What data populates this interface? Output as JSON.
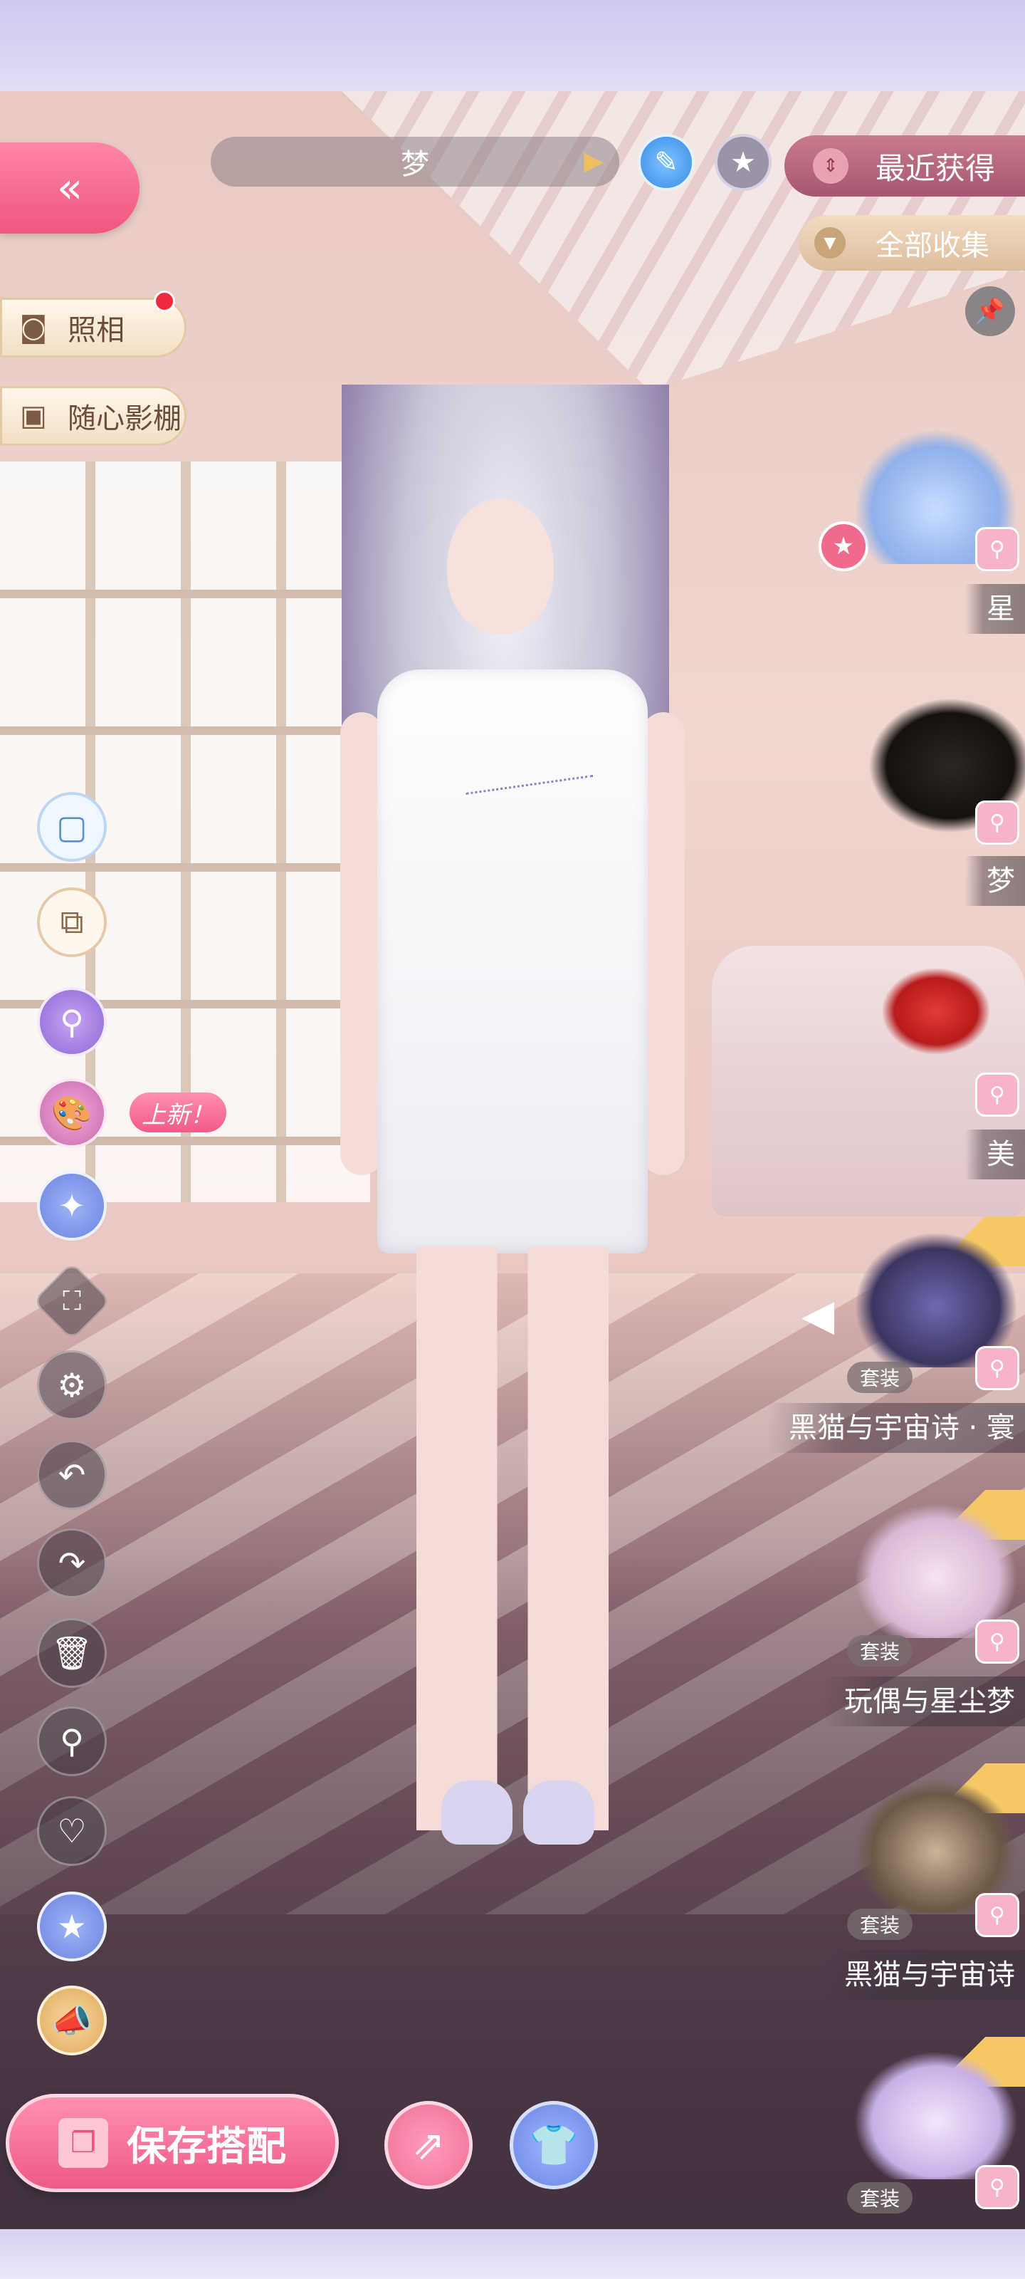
{
  "header": {
    "title": "梦",
    "recent_label": "最近获得",
    "all_label": "全部收集"
  },
  "left_menu": {
    "photo_label": "照相",
    "studio_label": "随心影棚",
    "new_badge": "上新！"
  },
  "items": [
    {
      "name": "星"
    },
    {
      "name": "梦"
    },
    {
      "name": "美"
    },
    {
      "name": "黑猫与宇宙诗 · 寰",
      "tag": "套装"
    },
    {
      "name": "玩偶与星尘梦",
      "tag": "套装"
    },
    {
      "name": "黑猫与宇宙诗",
      "tag": "套装"
    },
    {
      "name": "",
      "tag": "套装"
    }
  ],
  "bottom": {
    "save_label": "保存搭配"
  },
  "colors": {
    "accent_pink": "#f0567f",
    "gold": "#e1aa5b"
  }
}
